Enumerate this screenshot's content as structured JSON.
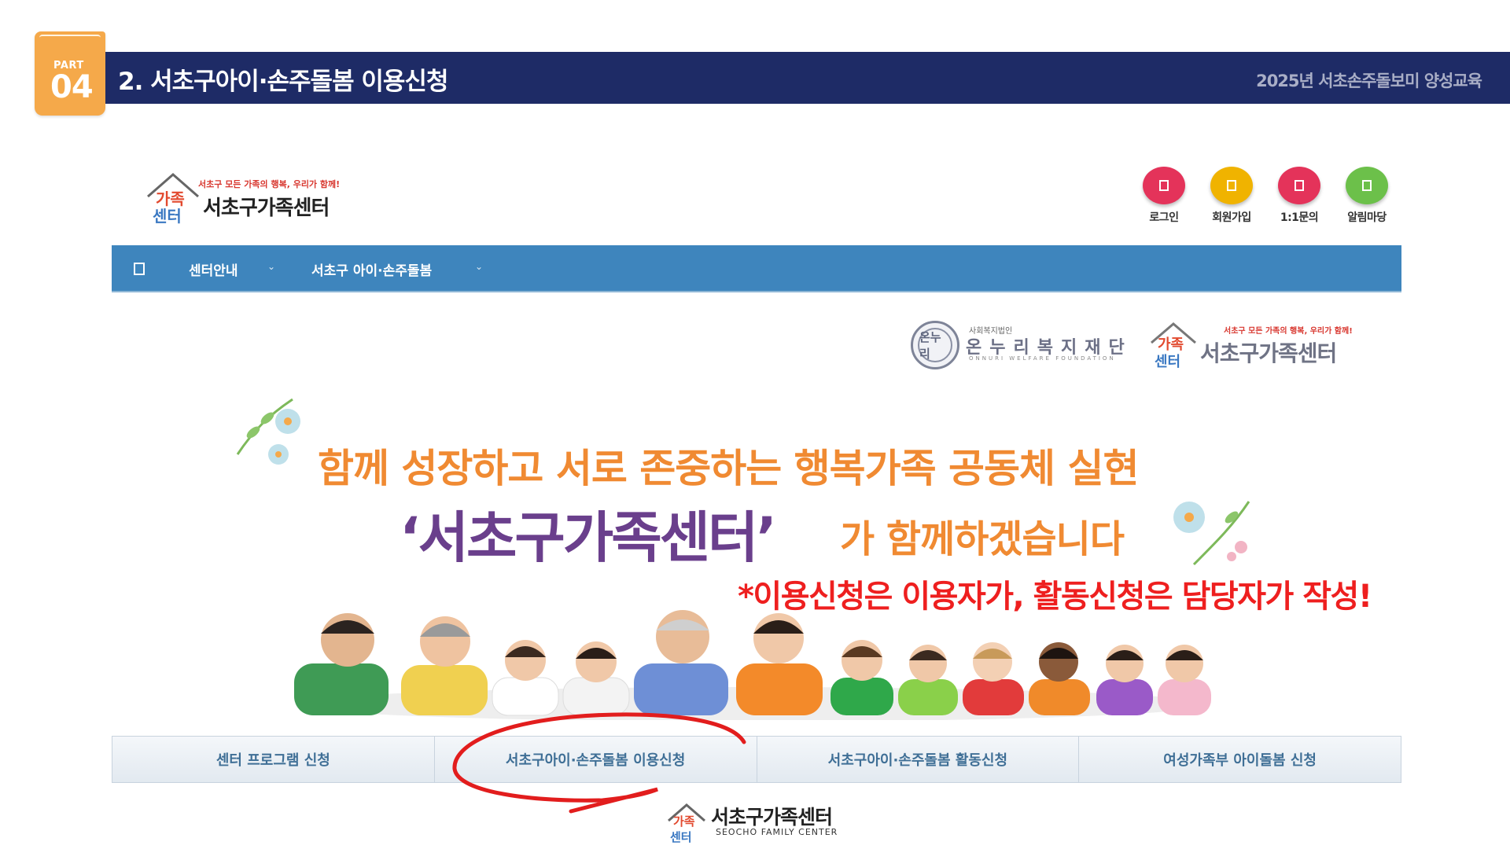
{
  "header": {
    "part_label": "PART",
    "part_number": "04",
    "title": "2. 서초구아이·손주돌봄 이용신청",
    "course": "2025년 서초손주돌보미 양성교육"
  },
  "site": {
    "logo_tagline": "서초구 모든 가족의 행복, 우리가 함께!",
    "logo_name": "서초구가족센터",
    "logo_mark_top": "가족",
    "logo_mark_bottom": "센터",
    "utility": [
      {
        "label": "로그인",
        "color": "#e4335a"
      },
      {
        "label": "회원가입",
        "color": "#f0b300"
      },
      {
        "label": "1:1문의",
        "color": "#e4335a"
      },
      {
        "label": "알림마당",
        "color": "#6cc04a"
      }
    ],
    "nav": [
      {
        "label": "센터안내"
      },
      {
        "label": "서초구 아이·손주돌봄"
      }
    ]
  },
  "partners": {
    "seal_text": "온누리",
    "onnuri_small": "사회복지법인",
    "onnuri_name": "온누리복지재단",
    "onnuri_en": "ONNURI WELFARE FOUNDATION",
    "family_tag": "서초구 모든 가족의 행복, 우리가 함께!",
    "family_name": "서초구가족센터"
  },
  "hero": {
    "line1": "함께 성장하고 서로 존중하는 행복가족 공동체 실현",
    "line2_quote": "‘서초구가족센터’",
    "line2_rest": "가 함께하겠습니다",
    "note": "*이용신청은 이용자가, 활동신청은 담당자가 작성!"
  },
  "tabs": [
    {
      "label": "센터 프로그램 신청"
    },
    {
      "label": "서초구아이·손주돌봄 이용신청"
    },
    {
      "label": "서초구아이·손주돌봄 활동신청"
    },
    {
      "label": "여성가족부 아이돌봄 신청"
    }
  ],
  "footer": {
    "name": "서초구가족센터",
    "english": "SEOCHO FAMILY CENTER"
  },
  "colors": {
    "title_bar": "#1e2b66",
    "badge": "#f5a94a",
    "nav": "#3e85bd",
    "highlight": "#ee1f1f",
    "hero_orange": "#f08a32",
    "hero_purple": "#6a3f8c"
  },
  "icons": {
    "menu": "hamburger-menu-icon",
    "login": "login-icon",
    "join": "join-icon",
    "inquiry": "inquiry-icon",
    "notice": "notice-icon"
  }
}
